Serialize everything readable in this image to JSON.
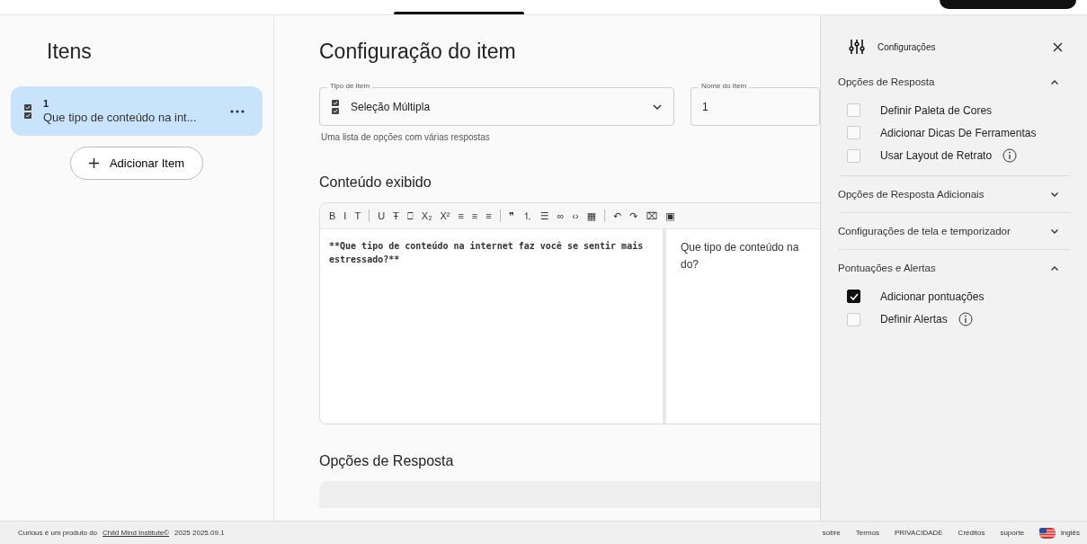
{
  "sidebar": {
    "title": "Itens",
    "items": [
      {
        "number": "1",
        "text": "Que tipo de conteúdo na int...",
        "selected": true
      }
    ],
    "add_button": "Adicionar Item"
  },
  "main": {
    "title": "Configuração do item",
    "item_type": {
      "label": "Tipo de Item",
      "value": "Seleção Múltipla",
      "helper": "Uma lista de opções com várias respostas"
    },
    "item_name": {
      "label": "Nome do Item",
      "value": "1"
    },
    "content_title": "Conteúdo exibido",
    "toolbar": [
      [
        "B",
        "I",
        "T"
      ],
      [
        "U",
        "Ŧ",
        "⎕",
        "X₂",
        "X²",
        "≡",
        "≡",
        "≡"
      ],
      [
        "❞",
        "⒈",
        "☰",
        "∞",
        "‹›",
        "▦"
      ],
      [
        "↶",
        "↷",
        "⌧",
        "▣"
      ]
    ],
    "editor_source": "**Que tipo de conteúdo na internet faz você se sentir mais estressado?**",
    "editor_preview": "Que tipo de conteúdo na do?",
    "answers_title": "Opções de Resposta"
  },
  "settings": {
    "title": "Configurações",
    "sections": [
      {
        "title": "Opções de Resposta",
        "expanded": true,
        "options": [
          {
            "label": "Definir Paleta de Cores",
            "checked": false,
            "info": false
          },
          {
            "label": "Adicionar Dicas De Ferramentas",
            "checked": false,
            "info": false
          },
          {
            "label": "Usar Layout de Retrato",
            "checked": false,
            "info": true
          }
        ]
      },
      {
        "title": "Opções de Resposta Adicionais",
        "expanded": false
      },
      {
        "title": "Configurações de tela e temporizador",
        "expanded": false
      },
      {
        "title": "Pontuações e Alertas",
        "expanded": true,
        "options": [
          {
            "label": "Adicionar pontuações",
            "checked": true,
            "info": false
          },
          {
            "label": "Definir Alertas",
            "checked": false,
            "info": true
          }
        ]
      }
    ]
  },
  "footer": {
    "prefix": "Curious é um produto do",
    "link": "Child Mind Institute©",
    "version": "2025 2025.09.1",
    "links": [
      "sobre",
      "Termos",
      "PRIVACIDADE",
      "Créditos",
      "suporte"
    ],
    "language": "inglês"
  }
}
